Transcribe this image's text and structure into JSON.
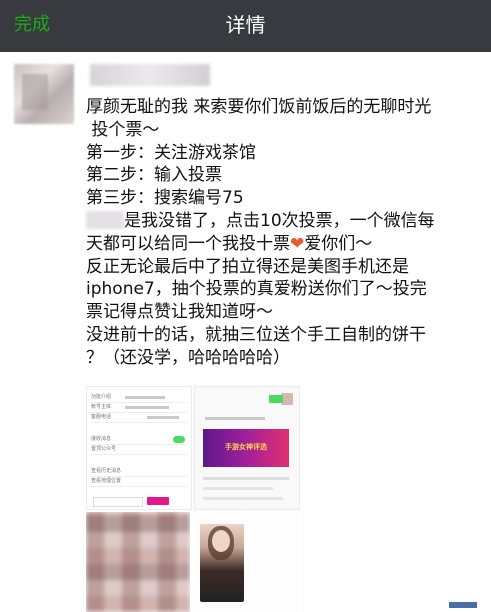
{
  "navbar": {
    "done_label": "完成",
    "title": "详情"
  },
  "post": {
    "line1": "厚颜无耻的我 来索要你们饭前饭后的无聊时光",
    "line2": " 投个票～",
    "line3": "第一步：关注游戏茶馆",
    "line4": "第二步：输入投票",
    "line5": "第三步：搜索编号75",
    "line6_after": "是我没错了，点击10次投票，一个微信每",
    "line7_before": "天都可以给同一个我投十票",
    "line7_heart": "❤",
    "line7_after": "爱你们～",
    "line8": "反正无论最后中了拍立得还是美图手机还是",
    "line9": "iphone7，抽个投票的真爱粉送你们了～投完",
    "line10": "票记得点赞让我知道呀～",
    "line11": "没进前十的话，就抽三位送个手工自制的饼干",
    "line12": "？（还没学，哈哈哈哈哈）"
  },
  "thumbs": {
    "t1_rows": [
      "功能介绍",
      "帐号主体",
      "客服电话",
      "接收消息",
      "置顶公众号",
      "查看历史消息",
      "查看地理位置"
    ],
    "t2_banner": "手游女神评选"
  },
  "colors": {
    "navbar_bg": "#393a3f",
    "done_green": "#1aad19",
    "heart": "#e85a2c"
  }
}
